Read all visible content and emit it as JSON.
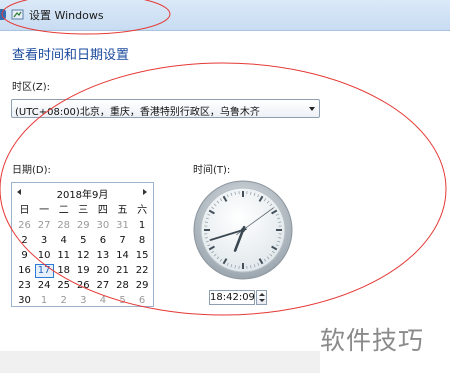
{
  "window": {
    "title": "设置 Windows"
  },
  "heading": "查看时间和日期设置",
  "timezone": {
    "label": "时区(Z):",
    "selected": "(UTC+08:00)北京，重庆，香港特别行政区，乌鲁木齐"
  },
  "date": {
    "label": "日期(D):",
    "month_title": "2018年9月",
    "weekdays": [
      "日",
      "一",
      "二",
      "三",
      "四",
      "五",
      "六"
    ],
    "weeks": [
      [
        "26",
        "27",
        "28",
        "29",
        "30",
        "31",
        "1"
      ],
      [
        "2",
        "3",
        "4",
        "5",
        "6",
        "7",
        "8"
      ],
      [
        "9",
        "10",
        "11",
        "12",
        "13",
        "14",
        "15"
      ],
      [
        "16",
        "17",
        "18",
        "19",
        "20",
        "21",
        "22"
      ],
      [
        "23",
        "24",
        "25",
        "26",
        "27",
        "28",
        "29"
      ],
      [
        "30",
        "1",
        "2",
        "3",
        "4",
        "5",
        "6"
      ]
    ],
    "selected_day": "17"
  },
  "time": {
    "label": "时间(T):",
    "value": "18:42:09",
    "clock": {
      "hour": 18,
      "minute": 42,
      "second": 9
    }
  },
  "watermark": "软件技巧",
  "colors": {
    "annotation": "#e53935",
    "heading": "#1a4a9e",
    "selection": "#2c7ad6"
  }
}
